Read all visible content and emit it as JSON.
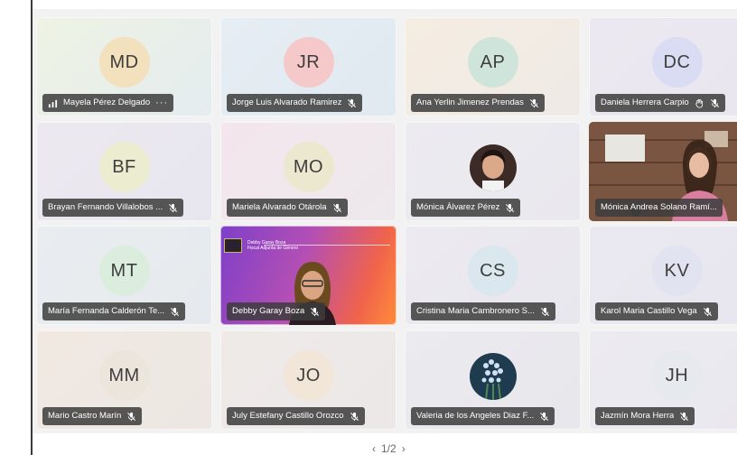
{
  "participants": [
    {
      "initials": "MD",
      "name": "Mayela Pérez Delgado",
      "status": "signal-more",
      "bg": "linear-gradient(135deg,#eef3e3,#e4ecef)",
      "av": "#f3e0bd"
    },
    {
      "initials": "JR",
      "name": "Jorge Luis Alvarado Ramirez",
      "status": "muted",
      "bg": "linear-gradient(135deg,#e6eef4,#dfe9ef)",
      "av": "#f5c9c9"
    },
    {
      "initials": "AP",
      "name": "Ana Yerlin Jimenez Prendas",
      "status": "muted",
      "bg": "linear-gradient(135deg,#f5ede2,#efeae6)",
      "av": "#cfe5dc"
    },
    {
      "initials": "DC",
      "name": "Daniela Herrera Carpio",
      "status": "hand-muted",
      "bg": "linear-gradient(135deg,#ece8f1,#e8e6ef)",
      "av": "#d9dcf3"
    },
    {
      "initials": "BF",
      "name": "Brayan Fernando Villalobos ...",
      "status": "muted",
      "bg": "linear-gradient(135deg,#ece8f0,#e7e6ee)",
      "av": "#ecedd0"
    },
    {
      "initials": "MO",
      "name": "Mariela Alvarado Otárola",
      "status": "muted",
      "bg": "linear-gradient(135deg,#f3e6ec,#ede9ec)",
      "av": "#ece7cf"
    },
    {
      "initials": "",
      "name": "Mónica Álvarez Pérez",
      "status": "muted",
      "bg": "linear-gradient(135deg,#ecebf0,#e9e8ee)",
      "photo": "portrait"
    },
    {
      "initials": "",
      "name": "Mónica Andrea Solano Ramí...",
      "status": "",
      "bg": "linear-gradient(135deg,#6b4a3a,#9a7560)",
      "photo": "room"
    },
    {
      "initials": "MT",
      "name": "María Fernanda Calderón Te...",
      "status": "muted",
      "bg": "linear-gradient(135deg,#e9edf0,#e6eaee)",
      "av": "#dbeede"
    },
    {
      "initials": "",
      "name": "Debby Garay Boza",
      "status": "muted",
      "bg": "linear-gradient(110deg,#7d3fc9 0%,#b44fb4 45%,#f0634b 80%,#ff8c3a 100%)",
      "photo": "presenter",
      "banner": "Debby Garay Boza",
      "banner_sub": "Fiscal Adjunta de Género"
    },
    {
      "initials": "CS",
      "name": "Cristina Maria Cambronero S...",
      "status": "muted",
      "bg": "linear-gradient(135deg,#eceaf0,#e8e7ed)",
      "av": "#dbe7ee"
    },
    {
      "initials": "KV",
      "name": "Karol Maria Castillo Vega",
      "status": "muted",
      "bg": "linear-gradient(135deg,#ebe9f0,#e7e5ee)",
      "av": "#e1e4f0"
    },
    {
      "initials": "MM",
      "name": "Mario Castro Marín",
      "status": "muted",
      "bg": "linear-gradient(135deg,#f1e9e1,#ece7e3)",
      "av": "#ece5dc"
    },
    {
      "initials": "JO",
      "name": "July Estefany Castillo Orozco",
      "status": "muted",
      "bg": "linear-gradient(135deg,#efeae8,#ebe8e7)",
      "av": "#f2e6d8"
    },
    {
      "initials": "",
      "name": "Valeria de los Angeles Diaz F...",
      "status": "muted",
      "bg": "linear-gradient(135deg,#ebeaef,#e8e7ec)",
      "photo": "flowers"
    },
    {
      "initials": "JH",
      "name": "Jazmín Mora Herra",
      "status": "muted",
      "bg": "linear-gradient(135deg,#ecebf1,#e9e8ee)",
      "av": "#e6e9ee"
    }
  ],
  "pager": {
    "prev": "‹",
    "page": "1/2",
    "next": "›"
  }
}
